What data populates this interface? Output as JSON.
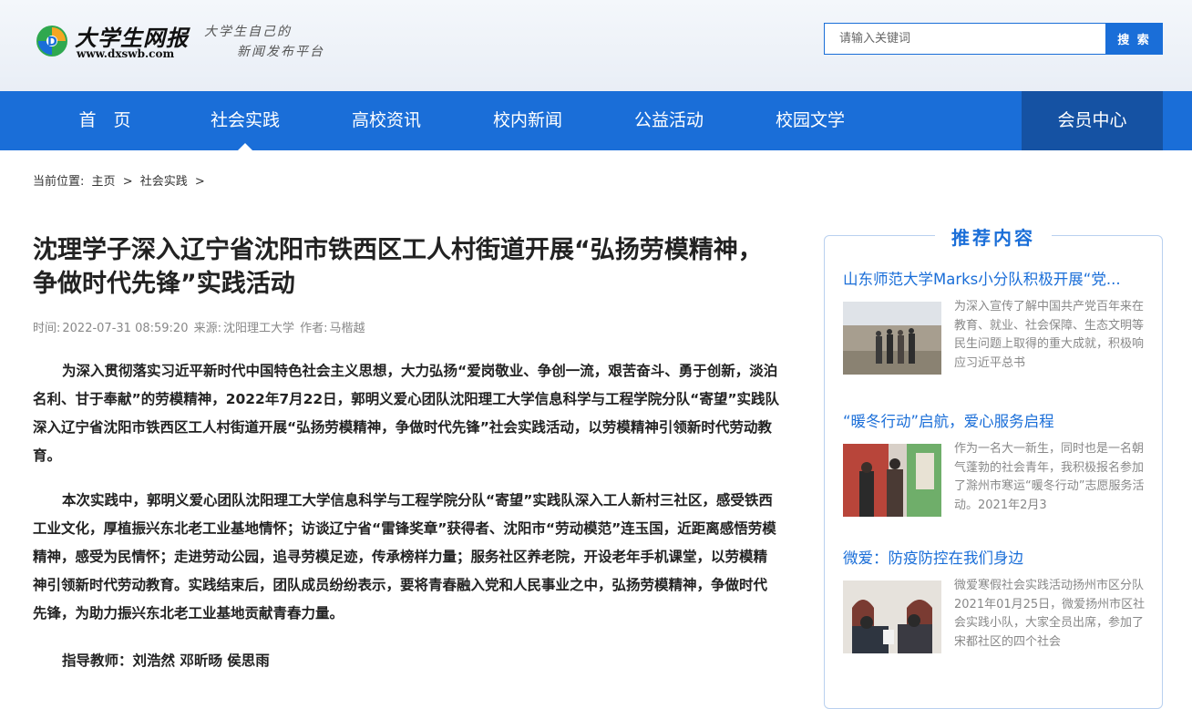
{
  "site": {
    "logo_name": "大学生网报",
    "logo_url": "www.dxswb.com",
    "slogan_line1": "大学生自己的",
    "slogan_line2": "新闻发布平台"
  },
  "search": {
    "placeholder": "请输入关键词",
    "button_label": "搜 索"
  },
  "nav": {
    "items": [
      {
        "label": "首　页"
      },
      {
        "label": "社会实践"
      },
      {
        "label": "高校资讯"
      },
      {
        "label": "校内新闻"
      },
      {
        "label": "公益活动"
      },
      {
        "label": "校园文学"
      }
    ],
    "active_index": 1,
    "member_label": "会员中心"
  },
  "breadcrumb": {
    "prefix": "当前位置:",
    "home": "主页",
    "sep": ">",
    "section": "社会实践"
  },
  "article": {
    "title": "沈理学子深入辽宁省沈阳市铁西区工人村街道开展“弘扬劳模精神，争做时代先锋”实践活动",
    "meta_time_label": "时间:",
    "meta_time": "2022-07-31 08:59:20",
    "meta_source_label": "来源:",
    "meta_source": "沈阳理工大学",
    "meta_author_label": "作者:",
    "meta_author": "马楷越",
    "paragraphs": [
      "为深入贯彻落实习近平新时代中国特色社会主义思想，大力弘扬“爱岗敬业、争创一流，艰苦奋斗、勇于创新，淡泊名利、甘于奉献”的劳模精神，2022年7月22日，郭明义爱心团队沈阳理工大学信息科学与工程学院分队“寄望”实践队深入辽宁省沈阳市铁西区工人村街道开展“弘扬劳模精神，争做时代先锋”社会实践活动，以劳模精神引领新时代劳动教育。",
      "本次实践中，郭明义爱心团队沈阳理工大学信息科学与工程学院分队“寄望”实践队深入工人新村三社区，感受铁西工业文化，厚植振兴东北老工业基地情怀；访谈辽宁省“雷锋奖章”获得者、沈阳市“劳动模范”连玉国，近距离感悟劳模精神，感受为民情怀；走进劳动公园，追寻劳模足迹，传承榜样力量；服务社区养老院，开设老年手机课堂，以劳模精神引领新时代劳动教育。实践结束后，团队成员纷纷表示，要将青春融入党和人民事业之中，弘扬劳模精神，争做时代先锋，为助力振兴东北老工业基地贡献青春力量。",
      "指导教师：刘浩然 邓昕旸 侯思雨"
    ]
  },
  "sidebar": {
    "title": "推荐内容",
    "items": [
      {
        "title": "山东师范大学Marks小分队积极开展“党...",
        "summary": "为深入宣传了解中国共产党百年来在教育、就业、社会保障、生态文明等民生问题上取得的重大成就，积极响应习近平总书"
      },
      {
        "title": "“暖冬行动”启航，爱心服务启程",
        "summary": "作为一名大一新生，同时也是一名朝气蓬勃的社会青年，我积极报名参加了滁州市寒运“暖冬行动”志愿服务活动。2021年2月3"
      },
      {
        "title": "微爱：防疫防控在我们身边",
        "summary": "微爱寒假社会实践活动扬州市区分队2021年01月25日，微爱扬州市区社会实践小队，大家全员出席，参加了宋都社区的四个社会"
      }
    ]
  },
  "colors": {
    "brand": "#1a6ed8",
    "brand_dark": "#1552a3"
  }
}
